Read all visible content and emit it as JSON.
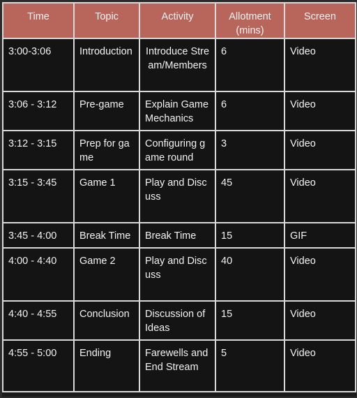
{
  "table": {
    "headers": [
      "Time",
      "Topic",
      "Activity",
      "Allotment\n(mins)",
      "Screen"
    ],
    "rows": [
      {
        "time": "3:00-3:06",
        "topic": "Introduction",
        "activity": "Introduce Stream/Members",
        "allotment": "6",
        "screen": "Video"
      },
      {
        "time": "3:06 - 3:12",
        "topic": "Pre-game",
        "activity": "Explain Game Mechanics",
        "allotment": "6",
        "screen": "Video"
      },
      {
        "time": "3:12 - 3:15",
        "topic": "Prep for game",
        "activity": "Configuring game round",
        "allotment": "3",
        "screen": "Video"
      },
      {
        "time": "3:15 - 3:45",
        "topic": "Game 1",
        "activity": "Play and Discuss",
        "allotment": "45",
        "screen": "Video"
      },
      {
        "time": "3:45 - 4:00",
        "topic": "Break Time",
        "activity": "Break Time",
        "allotment": "15",
        "screen": "GIF"
      },
      {
        "time": "4:00 - 4:40",
        "topic": "Game 2",
        "activity": "Play and Discuss",
        "allotment": "40",
        "screen": "Video"
      },
      {
        "time": "4:40 - 4:55",
        "topic": "Conclusion",
        "activity": "Discussion of Ideas",
        "allotment": "15",
        "screen": "Video"
      },
      {
        "time": "4:55 - 5:00",
        "topic": "Ending",
        "activity": "Farewells and End Stream",
        "allotment": "5",
        "screen": "Video"
      }
    ]
  }
}
